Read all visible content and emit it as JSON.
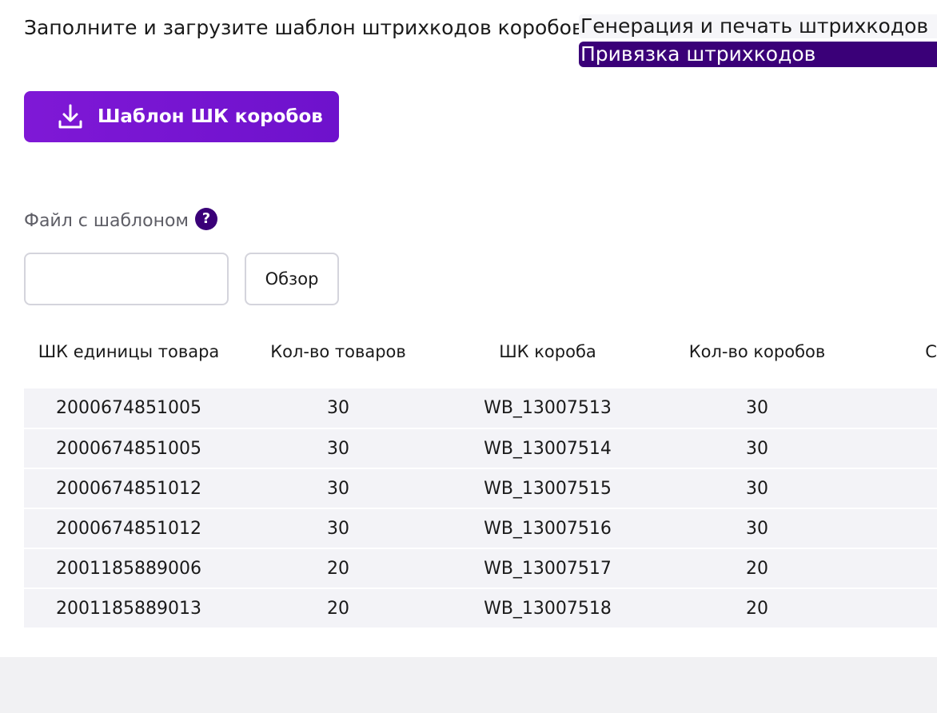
{
  "header": {
    "instruction": "Заполните и загрузите шаблон штрихкодов коробов",
    "tabs": [
      {
        "label": "Генерация и печать штрихкодов",
        "active": false
      },
      {
        "label": "Привязка штрихкодов",
        "active": true
      }
    ]
  },
  "download_button": {
    "label": "Шаблон ШК коробов",
    "icon": "download-icon"
  },
  "file_section": {
    "label": "Файл с шаблоном",
    "help_icon": "question-icon",
    "help_glyph": "?",
    "input_value": "",
    "browse_label": "Обзор"
  },
  "table": {
    "columns": [
      "ШК единицы товара",
      "Кол-во товаров",
      "ШК короба",
      "Кол-во коробов",
      "Срок"
    ],
    "rows": [
      [
        "2000674851005",
        "30",
        "WB_13007513",
        "30",
        ""
      ],
      [
        "2000674851005",
        "30",
        "WB_13007514",
        "30",
        ""
      ],
      [
        "2000674851012",
        "30",
        "WB_13007515",
        "30",
        ""
      ],
      [
        "2000674851012",
        "30",
        "WB_13007516",
        "30",
        ""
      ],
      [
        "2001185889006",
        "20",
        "WB_13007517",
        "20",
        ""
      ],
      [
        "2001185889013",
        "20",
        "WB_13007518",
        "20",
        ""
      ]
    ]
  },
  "colors": {
    "accent": "#7f18d6",
    "active_tab": "#3a0078",
    "row_bg": "#f3f3f7"
  }
}
